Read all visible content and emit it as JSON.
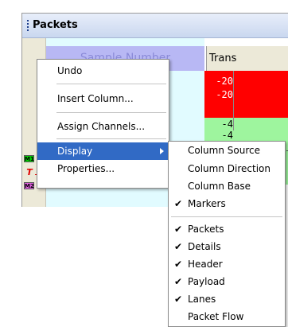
{
  "window": {
    "title": "Packets"
  },
  "grid": {
    "header_sample": "Sample Number",
    "header_trans": "Trans",
    "values": [
      "-20",
      "-20",
      "-4",
      "-4"
    ],
    "markers": {
      "m1": "M1",
      "t": "T",
      "m2": "M2"
    }
  },
  "menu": {
    "undo": "Undo",
    "insert_column": "Insert Column...",
    "assign_channels": "Assign Channels...",
    "display": "Display",
    "properties": "Properties..."
  },
  "submenu": {
    "items": [
      {
        "label": "Column Source",
        "checked": false
      },
      {
        "label": "Column Direction",
        "checked": false
      },
      {
        "label": "Column Base",
        "checked": false
      },
      {
        "label": "Markers",
        "checked": true
      },
      {
        "label": "Packets",
        "checked": true
      },
      {
        "label": "Details",
        "checked": true
      },
      {
        "label": "Header",
        "checked": true
      },
      {
        "label": "Payload",
        "checked": true
      },
      {
        "label": "Lanes",
        "checked": true
      },
      {
        "label": "Packet Flow",
        "checked": false
      }
    ],
    "check_glyph": "✔"
  },
  "colors": {
    "highlight": "#316ac5",
    "red_cell": "#ff0000",
    "green_cell": "#9ef59e"
  }
}
